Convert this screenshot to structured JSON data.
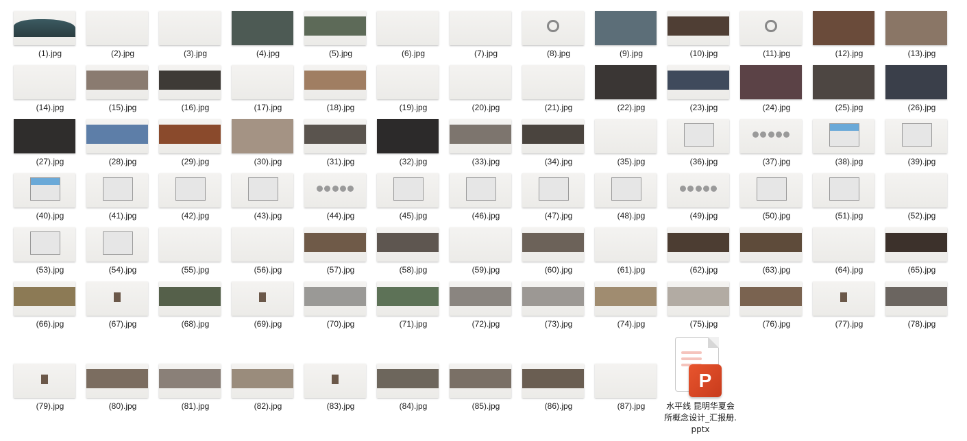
{
  "files": [
    {
      "label": "(1).jpg",
      "icon": "image-thumbnail-icon",
      "style": "hill"
    },
    {
      "label": "(2).jpg",
      "icon": "image-thumbnail-icon",
      "style": "plain"
    },
    {
      "label": "(3).jpg",
      "icon": "image-thumbnail-icon",
      "style": "plain"
    },
    {
      "label": "(4).jpg",
      "icon": "image-thumbnail-icon",
      "style": "wide",
      "color": "#4d5a54"
    },
    {
      "label": "(5).jpg",
      "icon": "image-thumbnail-icon",
      "style": "photo",
      "color": "#5d6a58"
    },
    {
      "label": "(6).jpg",
      "icon": "image-thumbnail-icon",
      "style": "plain"
    },
    {
      "label": "(7).jpg",
      "icon": "image-thumbnail-icon",
      "style": "plain"
    },
    {
      "label": "(8).jpg",
      "icon": "image-thumbnail-icon",
      "style": "circle"
    },
    {
      "label": "(9).jpg",
      "icon": "image-thumbnail-icon",
      "style": "wide",
      "color": "#5c6e78"
    },
    {
      "label": "(10).jpg",
      "icon": "image-thumbnail-icon",
      "style": "photo",
      "color": "#4f3e34"
    },
    {
      "label": "(11).jpg",
      "icon": "image-thumbnail-icon",
      "style": "circle"
    },
    {
      "label": "(12).jpg",
      "icon": "image-thumbnail-icon",
      "style": "wide",
      "color": "#6a4b3a"
    },
    {
      "label": "(13).jpg",
      "icon": "image-thumbnail-icon",
      "style": "wide",
      "color": "#8a7666"
    },
    {
      "label": "(14).jpg",
      "icon": "image-thumbnail-icon",
      "style": "plain"
    },
    {
      "label": "(15).jpg",
      "icon": "image-thumbnail-icon",
      "style": "photo",
      "color": "#8a7b70"
    },
    {
      "label": "(16).jpg",
      "icon": "image-thumbnail-icon",
      "style": "photo",
      "color": "#3e3a36"
    },
    {
      "label": "(17).jpg",
      "icon": "image-thumbnail-icon",
      "style": "plain"
    },
    {
      "label": "(18).jpg",
      "icon": "image-thumbnail-icon",
      "style": "photo",
      "color": "#a07e62"
    },
    {
      "label": "(19).jpg",
      "icon": "image-thumbnail-icon",
      "style": "plain"
    },
    {
      "label": "(20).jpg",
      "icon": "image-thumbnail-icon",
      "style": "plain"
    },
    {
      "label": "(21).jpg",
      "icon": "image-thumbnail-icon",
      "style": "plain"
    },
    {
      "label": "(22).jpg",
      "icon": "image-thumbnail-icon",
      "style": "wide",
      "color": "#3a3634"
    },
    {
      "label": "(23).jpg",
      "icon": "image-thumbnail-icon",
      "style": "photo",
      "color": "#3f4a5c"
    },
    {
      "label": "(24).jpg",
      "icon": "image-thumbnail-icon",
      "style": "wide",
      "color": "#5b4246"
    },
    {
      "label": "(25).jpg",
      "icon": "image-thumbnail-icon",
      "style": "wide",
      "color": "#4d4642"
    },
    {
      "label": "(26).jpg",
      "icon": "image-thumbnail-icon",
      "style": "wide",
      "color": "#3a3f4a"
    },
    {
      "label": "(27).jpg",
      "icon": "image-thumbnail-icon",
      "style": "wide",
      "color": "#2f2d2c"
    },
    {
      "label": "(28).jpg",
      "icon": "image-thumbnail-icon",
      "style": "photo",
      "color": "#5d7ea8"
    },
    {
      "label": "(29).jpg",
      "icon": "image-thumbnail-icon",
      "style": "photo",
      "color": "#8a4a2c"
    },
    {
      "label": "(30).jpg",
      "icon": "image-thumbnail-icon",
      "style": "wide",
      "color": "#a49384"
    },
    {
      "label": "(31).jpg",
      "icon": "image-thumbnail-icon",
      "style": "photo",
      "color": "#5a544e"
    },
    {
      "label": "(32).jpg",
      "icon": "image-thumbnail-icon",
      "style": "wide",
      "color": "#2c2a2a"
    },
    {
      "label": "(33).jpg",
      "icon": "image-thumbnail-icon",
      "style": "photo",
      "color": "#7d756e"
    },
    {
      "label": "(34).jpg",
      "icon": "image-thumbnail-icon",
      "style": "photo",
      "color": "#4a443e"
    },
    {
      "label": "(35).jpg",
      "icon": "image-thumbnail-icon",
      "style": "plain"
    },
    {
      "label": "(36).jpg",
      "icon": "image-thumbnail-icon",
      "style": "plan"
    },
    {
      "label": "(37).jpg",
      "icon": "image-thumbnail-icon",
      "style": "dots"
    },
    {
      "label": "(38).jpg",
      "icon": "image-thumbnail-icon",
      "style": "planblue"
    },
    {
      "label": "(39).jpg",
      "icon": "image-thumbnail-icon",
      "style": "plan"
    },
    {
      "label": "(40).jpg",
      "icon": "image-thumbnail-icon",
      "style": "planblue"
    },
    {
      "label": "(41).jpg",
      "icon": "image-thumbnail-icon",
      "style": "plan"
    },
    {
      "label": "(42).jpg",
      "icon": "image-thumbnail-icon",
      "style": "plan"
    },
    {
      "label": "(43).jpg",
      "icon": "image-thumbnail-icon",
      "style": "plan"
    },
    {
      "label": "(44).jpg",
      "icon": "image-thumbnail-icon",
      "style": "dots"
    },
    {
      "label": "(45).jpg",
      "icon": "image-thumbnail-icon",
      "style": "plan"
    },
    {
      "label": "(46).jpg",
      "icon": "image-thumbnail-icon",
      "style": "plan"
    },
    {
      "label": "(47).jpg",
      "icon": "image-thumbnail-icon",
      "style": "plan"
    },
    {
      "label": "(48).jpg",
      "icon": "image-thumbnail-icon",
      "style": "plan"
    },
    {
      "label": "(49).jpg",
      "icon": "image-thumbnail-icon",
      "style": "dots"
    },
    {
      "label": "(50).jpg",
      "icon": "image-thumbnail-icon",
      "style": "plan"
    },
    {
      "label": "(51).jpg",
      "icon": "image-thumbnail-icon",
      "style": "plan"
    },
    {
      "label": "(52).jpg",
      "icon": "image-thumbnail-icon",
      "style": "plain"
    },
    {
      "label": "(53).jpg",
      "icon": "image-thumbnail-icon",
      "style": "plan"
    },
    {
      "label": "(54).jpg",
      "icon": "image-thumbnail-icon",
      "style": "plan"
    },
    {
      "label": "(55).jpg",
      "icon": "image-thumbnail-icon",
      "style": "plain"
    },
    {
      "label": "(56).jpg",
      "icon": "image-thumbnail-icon",
      "style": "plain"
    },
    {
      "label": "(57).jpg",
      "icon": "image-thumbnail-icon",
      "style": "photo",
      "color": "#6f5a48"
    },
    {
      "label": "(58).jpg",
      "icon": "image-thumbnail-icon",
      "style": "photo",
      "color": "#5e5650"
    },
    {
      "label": "(59).jpg",
      "icon": "image-thumbnail-icon",
      "style": "plain"
    },
    {
      "label": "(60).jpg",
      "icon": "image-thumbnail-icon",
      "style": "photo",
      "color": "#6c6259"
    },
    {
      "label": "(61).jpg",
      "icon": "image-thumbnail-icon",
      "style": "plain"
    },
    {
      "label": "(62).jpg",
      "icon": "image-thumbnail-icon",
      "style": "photo",
      "color": "#4c3d32"
    },
    {
      "label": "(63).jpg",
      "icon": "image-thumbnail-icon",
      "style": "photo",
      "color": "#5e4b3a"
    },
    {
      "label": "(64).jpg",
      "icon": "image-thumbnail-icon",
      "style": "plain"
    },
    {
      "label": "(65).jpg",
      "icon": "image-thumbnail-icon",
      "style": "photo",
      "color": "#3c312b"
    },
    {
      "label": "(66).jpg",
      "icon": "image-thumbnail-icon",
      "style": "photo",
      "color": "#8c7a55"
    },
    {
      "label": "(67).jpg",
      "icon": "image-thumbnail-icon",
      "style": "small"
    },
    {
      "label": "(68).jpg",
      "icon": "image-thumbnail-icon",
      "style": "photo",
      "color": "#55604a"
    },
    {
      "label": "(69).jpg",
      "icon": "image-thumbnail-icon",
      "style": "small"
    },
    {
      "label": "(70).jpg",
      "icon": "image-thumbnail-icon",
      "style": "photo",
      "color": "#9a9996"
    },
    {
      "label": "(71).jpg",
      "icon": "image-thumbnail-icon",
      "style": "photo",
      "color": "#5d7257"
    },
    {
      "label": "(72).jpg",
      "icon": "image-thumbnail-icon",
      "style": "photo",
      "color": "#8a8580"
    },
    {
      "label": "(73).jpg",
      "icon": "image-thumbnail-icon",
      "style": "photo",
      "color": "#9c9894"
    },
    {
      "label": "(74).jpg",
      "icon": "image-thumbnail-icon",
      "style": "photo",
      "color": "#a08c70"
    },
    {
      "label": "(75).jpg",
      "icon": "image-thumbnail-icon",
      "style": "photo",
      "color": "#b2aba3"
    },
    {
      "label": "(76).jpg",
      "icon": "image-thumbnail-icon",
      "style": "photo",
      "color": "#7a6350"
    },
    {
      "label": "(77).jpg",
      "icon": "image-thumbnail-icon",
      "style": "small"
    },
    {
      "label": "(78).jpg",
      "icon": "image-thumbnail-icon",
      "style": "photo",
      "color": "#6b6560"
    },
    {
      "label": "(79).jpg",
      "icon": "image-thumbnail-icon",
      "style": "small"
    },
    {
      "label": "(80).jpg",
      "icon": "image-thumbnail-icon",
      "style": "photo",
      "color": "#7b6d60"
    },
    {
      "label": "(81).jpg",
      "icon": "image-thumbnail-icon",
      "style": "photo",
      "color": "#8a8078"
    },
    {
      "label": "(82).jpg",
      "icon": "image-thumbnail-icon",
      "style": "photo",
      "color": "#9a8c7c"
    },
    {
      "label": "(83).jpg",
      "icon": "image-thumbnail-icon",
      "style": "small"
    },
    {
      "label": "(84).jpg",
      "icon": "image-thumbnail-icon",
      "style": "photo",
      "color": "#6d665c"
    },
    {
      "label": "(85).jpg",
      "icon": "image-thumbnail-icon",
      "style": "photo",
      "color": "#7a7066"
    },
    {
      "label": "(86).jpg",
      "icon": "image-thumbnail-icon",
      "style": "photo",
      "color": "#6a5e52"
    },
    {
      "label": "(87).jpg",
      "icon": "image-thumbnail-icon",
      "style": "plain"
    }
  ],
  "pptx": {
    "name": "水平线 昆明华夏会所概念设计_汇报册.pptx",
    "badge": "P",
    "icon": "powerpoint-file-icon",
    "accent": "#d9482a"
  }
}
